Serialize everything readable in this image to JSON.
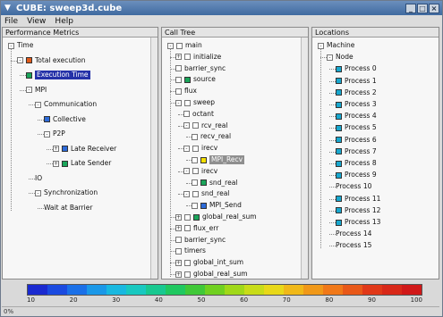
{
  "window": {
    "title": "CUBE: sweep3d.cube",
    "menu": [
      "File",
      "View",
      "Help"
    ]
  },
  "panels": {
    "metric": {
      "header": "Performance Metrics",
      "rows": [
        {
          "label": "Time",
          "color": "",
          "expander": "-",
          "indent": 0,
          "selected": false
        },
        {
          "label": "Total execution",
          "color": "#e05a1a",
          "expander": "-",
          "indent": 1,
          "selected": false
        },
        {
          "label": "Execution Time",
          "color": "#1aa55a",
          "expander": "",
          "indent": 2,
          "selected": true
        },
        {
          "label": "MPI",
          "color": "",
          "expander": "-",
          "indent": 2,
          "selected": false
        },
        {
          "label": "Communication",
          "color": "",
          "expander": "-",
          "indent": 3,
          "selected": false
        },
        {
          "label": "Collective",
          "color": "#2d6bd9",
          "expander": "",
          "indent": 4,
          "selected": false
        },
        {
          "label": "P2P",
          "color": "",
          "expander": "-",
          "indent": 4,
          "selected": false
        },
        {
          "label": "Late Receiver",
          "color": "#2d6bd9",
          "expander": "+",
          "indent": 5,
          "selected": false
        },
        {
          "label": "Late Sender",
          "color": "#1aa55a",
          "expander": "+",
          "indent": 5,
          "selected": false
        },
        {
          "label": "IO",
          "color": "",
          "expander": "",
          "indent": 3,
          "selected": false
        },
        {
          "label": "Synchronization",
          "color": "",
          "expander": "-",
          "indent": 3,
          "selected": false
        },
        {
          "label": "Wait at Barrier",
          "color": "",
          "expander": "",
          "indent": 4,
          "selected": false
        }
      ]
    },
    "call": {
      "header": "Call Tree",
      "rows": [
        {
          "label": "main",
          "color": "",
          "expander": "-",
          "indent": 0,
          "selected": ""
        },
        {
          "label": "initialize",
          "color": "",
          "expander": "+",
          "indent": 1,
          "selected": ""
        },
        {
          "label": "barrier_sync",
          "color": "",
          "expander": "",
          "indent": 1,
          "selected": ""
        },
        {
          "label": "source",
          "color": "#1aa55a",
          "expander": "",
          "indent": 1,
          "selected": ""
        },
        {
          "label": "flux",
          "color": "",
          "expander": "",
          "indent": 1,
          "selected": ""
        },
        {
          "label": "sweep",
          "color": "",
          "expander": "-",
          "indent": 1,
          "selected": ""
        },
        {
          "label": "octant",
          "color": "",
          "expander": "",
          "indent": 2,
          "selected": ""
        },
        {
          "label": "rcv_real",
          "color": "",
          "expander": "-",
          "indent": 2,
          "selected": ""
        },
        {
          "label": "recv_real",
          "color": "",
          "expander": "",
          "indent": 3,
          "selected": ""
        },
        {
          "label": "irecv",
          "color": "",
          "expander": "-",
          "indent": 2,
          "selected": ""
        },
        {
          "label": "MPI_Recv",
          "color": "#f5e000",
          "expander": "",
          "indent": 3,
          "selected": "gray"
        },
        {
          "label": "irecv",
          "color": "",
          "expander": "-",
          "indent": 2,
          "selected": ""
        },
        {
          "label": "snd_real",
          "color": "#1aa55a",
          "expander": "",
          "indent": 3,
          "selected": ""
        },
        {
          "label": "snd_real",
          "color": "",
          "expander": "-",
          "indent": 2,
          "selected": ""
        },
        {
          "label": "MPI_Send",
          "color": "#2d6bd9",
          "expander": "",
          "indent": 3,
          "selected": ""
        },
        {
          "label": "global_real_sum",
          "color": "#1aa55a",
          "expander": "+",
          "indent": 1,
          "selected": ""
        },
        {
          "label": "flux_err",
          "color": "",
          "expander": "+",
          "indent": 1,
          "selected": ""
        },
        {
          "label": "barrier_sync",
          "color": "",
          "expander": "",
          "indent": 1,
          "selected": ""
        },
        {
          "label": "timers",
          "color": "",
          "expander": "",
          "indent": 1,
          "selected": ""
        },
        {
          "label": "global_int_sum",
          "color": "",
          "expander": "+",
          "indent": 1,
          "selected": ""
        },
        {
          "label": "global_real_sum",
          "color": "",
          "expander": "+",
          "indent": 1,
          "selected": ""
        }
      ]
    },
    "system": {
      "header": "Locations",
      "rows": [
        {
          "label": "Machine",
          "color": "",
          "expander": "-",
          "indent": 0
        },
        {
          "label": "Node",
          "color": "",
          "expander": "-",
          "indent": 1
        },
        {
          "label": "Process 0",
          "color": "#18a8cf",
          "expander": "",
          "indent": 2
        },
        {
          "label": "Process 1",
          "color": "#18a8cf",
          "expander": "",
          "indent": 2
        },
        {
          "label": "Process 2",
          "color": "#18a8cf",
          "expander": "",
          "indent": 2
        },
        {
          "label": "Process 3",
          "color": "#18a8cf",
          "expander": "",
          "indent": 2
        },
        {
          "label": "Process 4",
          "color": "#18a8cf",
          "expander": "",
          "indent": 2
        },
        {
          "label": "Process 5",
          "color": "#18a8cf",
          "expander": "",
          "indent": 2
        },
        {
          "label": "Process 6",
          "color": "#18a8cf",
          "expander": "",
          "indent": 2
        },
        {
          "label": "Process 7",
          "color": "#18a8cf",
          "expander": "",
          "indent": 2
        },
        {
          "label": "Process 8",
          "color": "#18a8cf",
          "expander": "",
          "indent": 2
        },
        {
          "label": "Process 9",
          "color": "#18a8cf",
          "expander": "",
          "indent": 2
        },
        {
          "label": "Process 10",
          "color": "",
          "expander": "",
          "indent": 2
        },
        {
          "label": "Process 11",
          "color": "#18a8cf",
          "expander": "",
          "indent": 2
        },
        {
          "label": "Process 12",
          "color": "#18a8cf",
          "expander": "",
          "indent": 2
        },
        {
          "label": "Process 13",
          "color": "#18a8cf",
          "expander": "",
          "indent": 2
        },
        {
          "label": "Process 14",
          "color": "",
          "expander": "",
          "indent": 2
        },
        {
          "label": "Process 15",
          "color": "",
          "expander": "",
          "indent": 2
        }
      ]
    }
  },
  "colorbar": {
    "colors": [
      "#1a2ad0",
      "#1a4ae0",
      "#1a70e8",
      "#1a98e8",
      "#18b8e0",
      "#18c8c0",
      "#18c890",
      "#20c860",
      "#40c838",
      "#70d020",
      "#a0d818",
      "#c8dc18",
      "#e8d818",
      "#f0b818",
      "#f09818",
      "#f07818",
      "#e85818",
      "#e03818",
      "#d82818",
      "#d01818"
    ],
    "ticks": [
      "10",
      "20",
      "30",
      "40",
      "50",
      "60",
      "70",
      "80",
      "90",
      "100"
    ]
  },
  "status": "0%"
}
